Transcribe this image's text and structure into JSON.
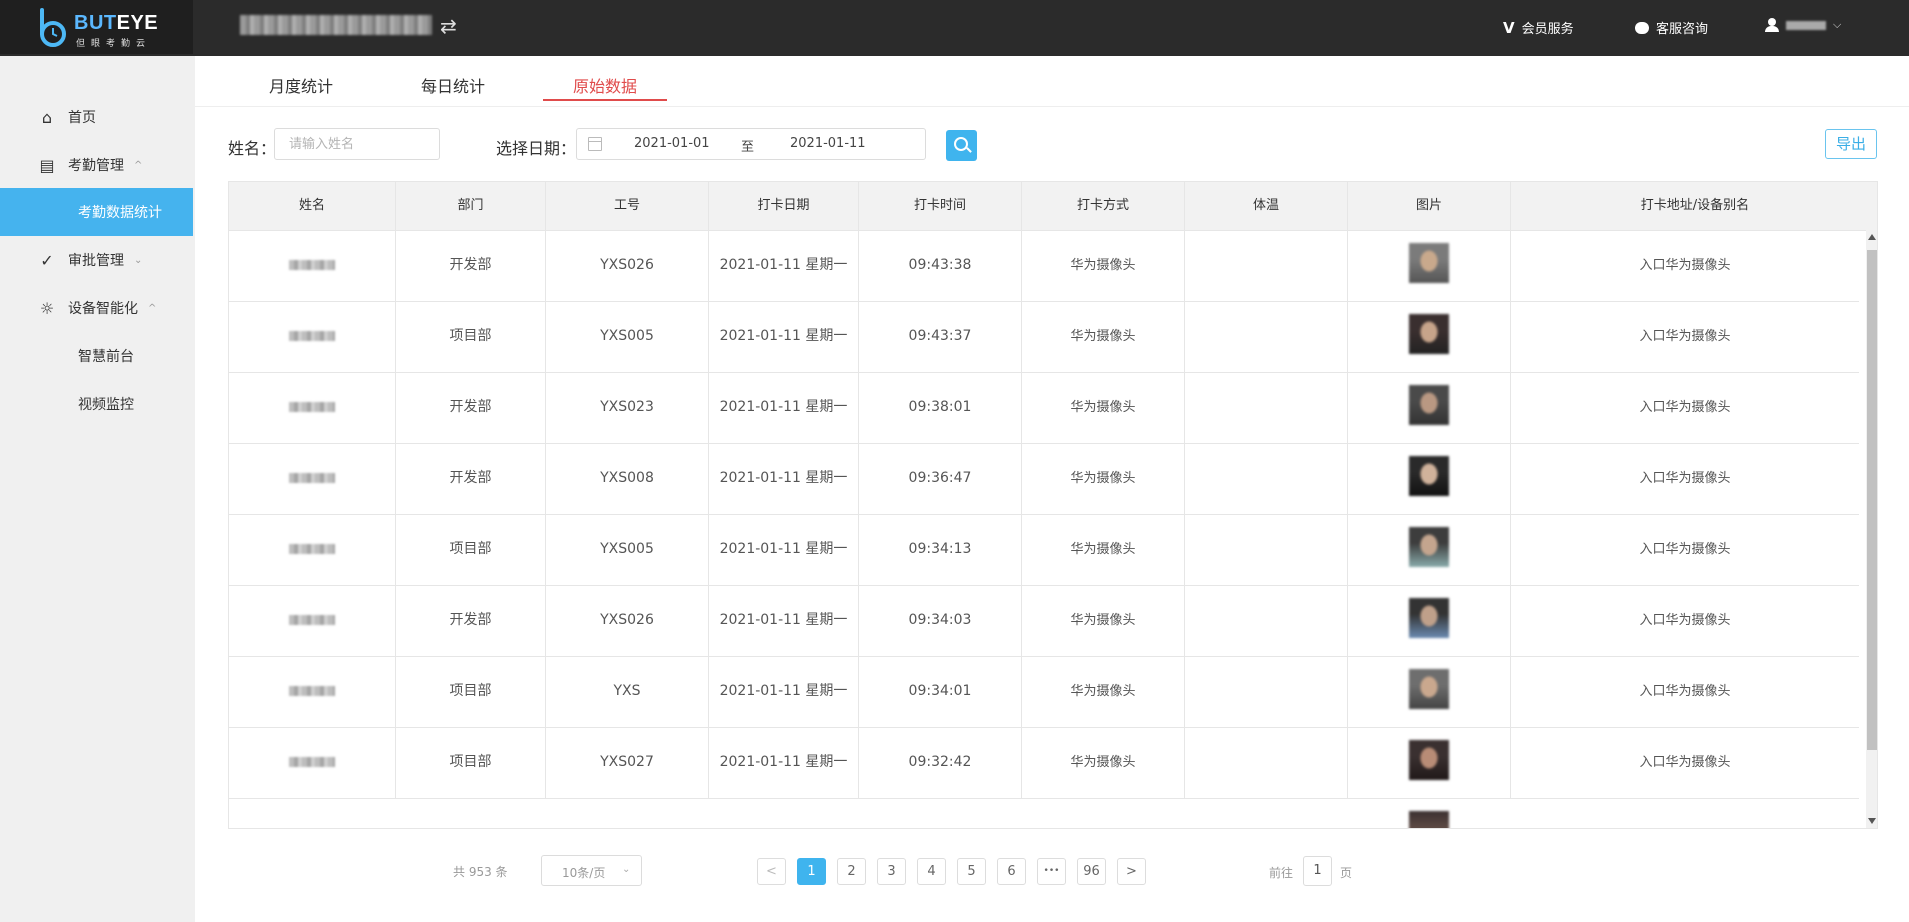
{
  "header": {
    "logo_text_blue": "BUT",
    "logo_text_white": "EYE",
    "logo_sub": "但眼考勤云",
    "switch_icon": "⇄",
    "vip_icon": "V",
    "vip_label": "会员服务",
    "service_label": "客服咨询",
    "user_caret": "⌵"
  },
  "sidebar": {
    "items": [
      {
        "label": "首页",
        "icon": "home-icon",
        "glyph": "⌂"
      },
      {
        "label": "考勤管理",
        "icon": "calendar-chart-icon",
        "glyph": "▤",
        "arrow": "^"
      },
      {
        "label": "考勤数据统计"
      },
      {
        "label": "审批管理",
        "icon": "check-circle-icon",
        "glyph": "✓",
        "arrow": "⌄"
      },
      {
        "label": "设备智能化",
        "icon": "bulb-icon",
        "glyph": "☼",
        "arrow": "^"
      },
      {
        "label": "智慧前台"
      },
      {
        "label": "视频监控"
      }
    ]
  },
  "tabs": [
    "月度统计",
    "每日统计",
    "原始数据"
  ],
  "filters": {
    "name_label": "姓名：",
    "name_placeholder": "请输入姓名",
    "date_label": "选择日期：",
    "date_start": "2021-01-01",
    "date_sep": "至",
    "date_end": "2021-01-11",
    "export_label": "导出"
  },
  "table": {
    "columns": [
      "姓名",
      "部门",
      "工号",
      "打卡日期",
      "打卡时间",
      "打卡方式",
      "体温",
      "图片",
      "打卡地址/设备别名"
    ],
    "rows": [
      {
        "dept": "开发部",
        "id": "YXS026",
        "date": "2021-01-11 星期一",
        "time": "09:43:38",
        "method": "华为摄像头",
        "temp": "",
        "addr": "入口华为摄像头"
      },
      {
        "dept": "项目部",
        "id": "YXS005",
        "date": "2021-01-11 星期一",
        "time": "09:43:37",
        "method": "华为摄像头",
        "temp": "",
        "addr": "入口华为摄像头"
      },
      {
        "dept": "开发部",
        "id": "YXS023",
        "date": "2021-01-11 星期一",
        "time": "09:38:01",
        "method": "华为摄像头",
        "temp": "",
        "addr": "入口华为摄像头"
      },
      {
        "dept": "开发部",
        "id": "YXS008",
        "date": "2021-01-11 星期一",
        "time": "09:36:47",
        "method": "华为摄像头",
        "temp": "",
        "addr": "入口华为摄像头"
      },
      {
        "dept": "项目部",
        "id": "YXS005",
        "date": "2021-01-11 星期一",
        "time": "09:34:13",
        "method": "华为摄像头",
        "temp": "",
        "addr": "入口华为摄像头"
      },
      {
        "dept": "开发部",
        "id": "YXS026",
        "date": "2021-01-11 星期一",
        "time": "09:34:03",
        "method": "华为摄像头",
        "temp": "",
        "addr": "入口华为摄像头"
      },
      {
        "dept": "项目部",
        "id": "YXS",
        "date": "2021-01-11 星期一",
        "time": "09:34:01",
        "method": "华为摄像头",
        "temp": "",
        "addr": "入口华为摄像头"
      },
      {
        "dept": "项目部",
        "id": "YXS027",
        "date": "2021-01-11 星期一",
        "time": "09:32:42",
        "method": "华为摄像头",
        "temp": "",
        "addr": "入口华为摄像头"
      }
    ]
  },
  "pagination": {
    "total": "共 953 条",
    "page_size": "10条/页",
    "page_size_arrow": "⌄",
    "prev": "<",
    "next": ">",
    "pages": [
      "1",
      "2",
      "3",
      "4",
      "5",
      "6",
      "•••",
      "96"
    ],
    "current_page": "1",
    "goto_prefix": "前往",
    "goto_value": "1",
    "goto_suffix": "页"
  },
  "colors": {
    "accent": "#3fb4ee",
    "active_tab": "#e04b4b",
    "topbar": "#2b2b2b",
    "sidebar_bg": "#f0f0f0"
  }
}
